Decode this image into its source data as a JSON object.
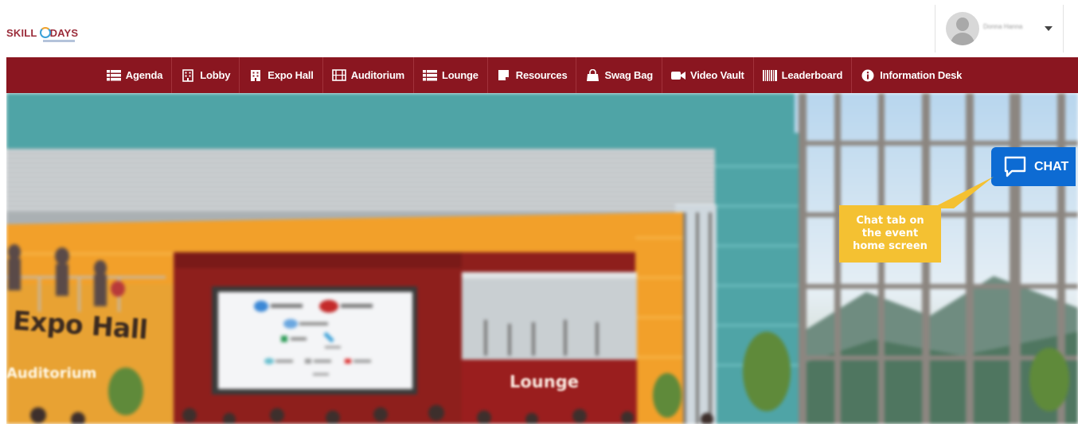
{
  "header": {
    "logo_text_left": "SKILL",
    "logo_text_right": "DAYS",
    "user_name": "Donna Hanna"
  },
  "nav": {
    "items": [
      {
        "label": "Agenda",
        "icon": "list-icon"
      },
      {
        "label": "Lobby",
        "icon": "building-icon"
      },
      {
        "label": "Expo Hall",
        "icon": "building-icon"
      },
      {
        "label": "Auditorium",
        "icon": "film-icon"
      },
      {
        "label": "Lounge",
        "icon": "list-icon"
      },
      {
        "label": "Resources",
        "icon": "note-icon"
      },
      {
        "label": "Swag Bag",
        "icon": "shopping-bag-icon"
      },
      {
        "label": "Video Vault",
        "icon": "video-camera-icon"
      },
      {
        "label": "Leaderboard",
        "icon": "barcode-icon"
      },
      {
        "label": "Information Desk",
        "icon": "info-circle-icon"
      }
    ]
  },
  "scene": {
    "expo_sign": "Expo Hall",
    "auditorium_sign": "Auditorium",
    "lounge_sign": "Lounge"
  },
  "chat": {
    "label": "CHAT",
    "callout": "Chat tab on the event home screen"
  },
  "colors": {
    "nav_bg": "#8a1620",
    "chat_blue": "#0d6bd3",
    "callout_yellow": "#f4c132",
    "wall_orange": "#f2a02a",
    "teal": "#4fa4a6"
  }
}
